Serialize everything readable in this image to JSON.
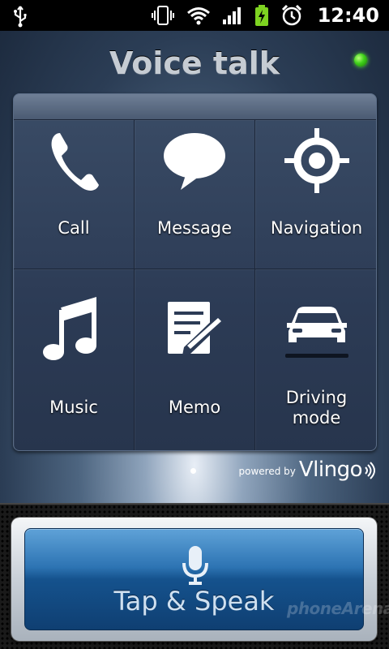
{
  "status_bar": {
    "time": "12:40",
    "icons": [
      "usb-icon",
      "vibrate-icon",
      "wifi-icon",
      "signal-icon",
      "battery-charging-icon",
      "alarm-icon"
    ],
    "battery_color": "#7ed321"
  },
  "app": {
    "title": "Voice talk",
    "status_led_color": "#3fd11a"
  },
  "tiles": [
    {
      "label": "Call",
      "icon": "phone-icon"
    },
    {
      "label": "Message",
      "icon": "speech-bubble-icon"
    },
    {
      "label": "Navigation",
      "icon": "crosshair-icon"
    },
    {
      "label": "Music",
      "icon": "music-note-icon"
    },
    {
      "label": "Memo",
      "icon": "memo-pencil-icon"
    },
    {
      "label": "Driving mode",
      "icon": "car-icon"
    }
  ],
  "powered": {
    "prefix": "powered by",
    "brand": "Vlingo"
  },
  "speak_button": {
    "label": "Tap & Speak",
    "icon": "microphone-icon",
    "color": "#2d74b3"
  },
  "watermark": {
    "text": "phoneArena"
  }
}
